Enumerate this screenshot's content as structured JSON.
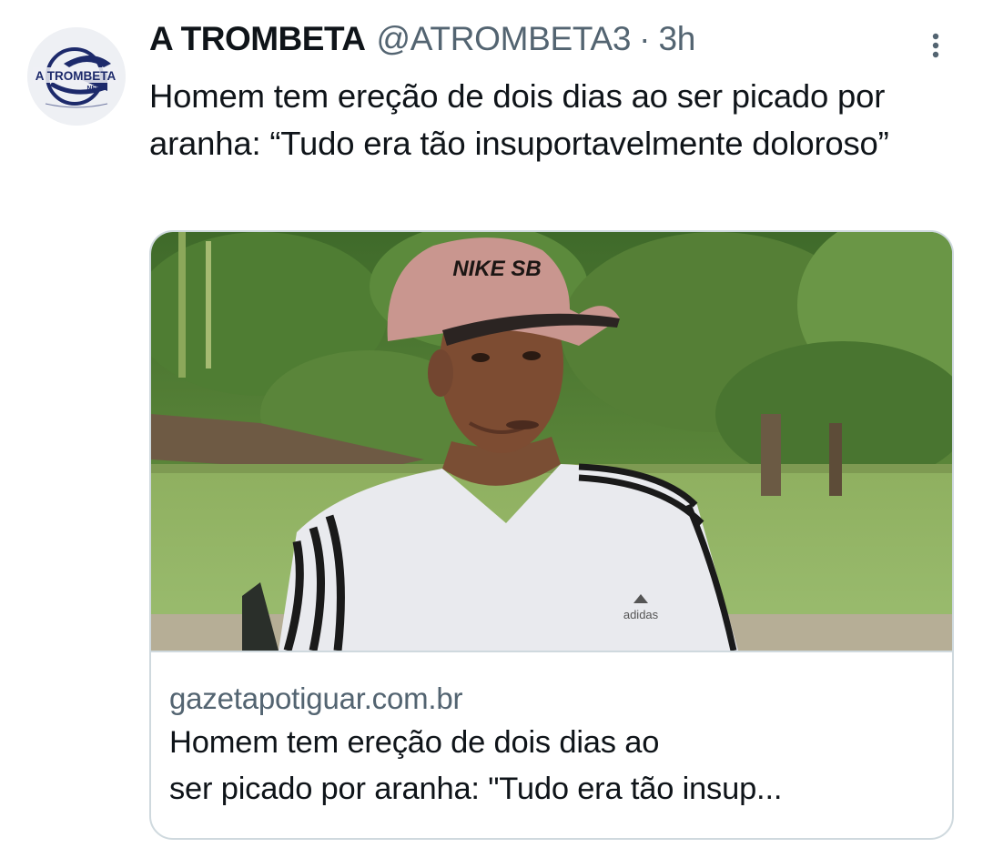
{
  "tweet": {
    "author": {
      "name": "A TROMBETA",
      "handle": "@ATROMBETA3",
      "avatar_logo_text": "A TROMBETA",
      "avatar_logo_subtext": "NEWS"
    },
    "separator": "·",
    "time": "3h",
    "text": "Homem tem ereção de dois dias ao ser picado por aranha: “Tudo era tão insuportavelmente doloroso”",
    "more_icon": "vertical-dots-icon"
  },
  "card": {
    "domain": "gazetapotiguar.com.br",
    "title_line1": "Homem tem ereção de dois dias ao",
    "title_line2": "ser picado por aranha: \"Tudo era tão insup...",
    "image_brands": {
      "cap": "NIKE SB",
      "shirt": "adidas"
    }
  },
  "colors": {
    "text_primary": "#0f1419",
    "text_secondary": "#536471",
    "border": "#cfd9de",
    "cap": "#c9968f",
    "logo_blue": "#1d2a6b"
  }
}
